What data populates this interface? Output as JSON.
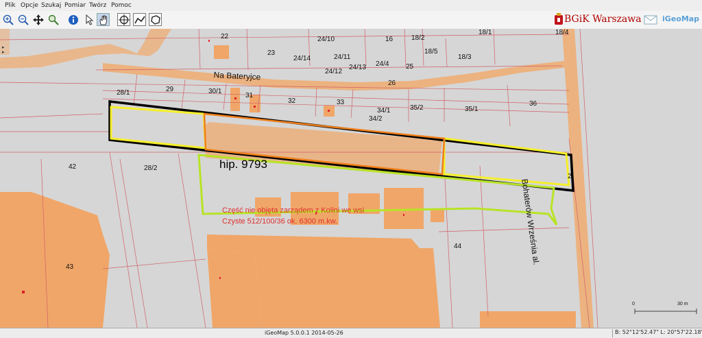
{
  "menu": [
    "Plik",
    "Opcje",
    "Szukaj",
    "Pomiar",
    "Twórz",
    "Pomoc"
  ],
  "toolbar": {
    "tools": [
      {
        "name": "zoom-in-icon",
        "glyph": "⊕"
      },
      {
        "name": "zoom-out-icon",
        "glyph": "⊖"
      },
      {
        "name": "pan-icon",
        "glyph": "✥"
      },
      {
        "name": "zoom-extent-icon",
        "glyph": "⚲"
      },
      {
        "name": "info-icon",
        "glyph": "i"
      },
      {
        "name": "select-arrow-icon",
        "glyph": "↖"
      },
      {
        "name": "hand-icon",
        "glyph": "✋"
      },
      {
        "name": "crosshair-icon",
        "glyph": "⊕"
      },
      {
        "name": "measure-line-icon",
        "glyph": "〰"
      },
      {
        "name": "measure-area-icon",
        "glyph": "◇"
      }
    ]
  },
  "brand": {
    "name": "BGiK Warszawa",
    "app": "iGeoMap"
  },
  "map": {
    "parcel_labels": [
      "22",
      "23",
      "24/10",
      "16",
      "18/2",
      "18/1",
      "18/4",
      "24/14",
      "24/11",
      "18/5",
      "18/3",
      "24/4",
      "24/13",
      "25",
      "24/12",
      "26",
      "28/1",
      "29",
      "30/1",
      "31",
      "32",
      "33",
      "34/1",
      "35/2",
      "35/1",
      "36",
      "34/2",
      "42",
      "28/2",
      "2",
      "44",
      "43"
    ],
    "streets": [
      "Na Bateryjce",
      "Bohaterów Września al."
    ],
    "hip_label": "hip. 9793",
    "note_lines": [
      "Część nie objęta zarządem z Kolini we wsi",
      "Czyste 512/100/36  ok. 6300 m.kw."
    ],
    "scale": {
      "start": "0",
      "end": "30 m"
    }
  },
  "colors": {
    "building": "#f0a668",
    "parcel_line": "#d0606a",
    "hip_outline": "#f07f1a",
    "highlight": "#f5ef2a",
    "boundary": "#000000",
    "excluded_area": "#b8e326",
    "road": "#ecb27f"
  },
  "status": {
    "version": "iGeoMap 5.0.0.1 2014-05-26",
    "coords": "B: 52°12'52.47\" L: 20°57'22.18\""
  }
}
